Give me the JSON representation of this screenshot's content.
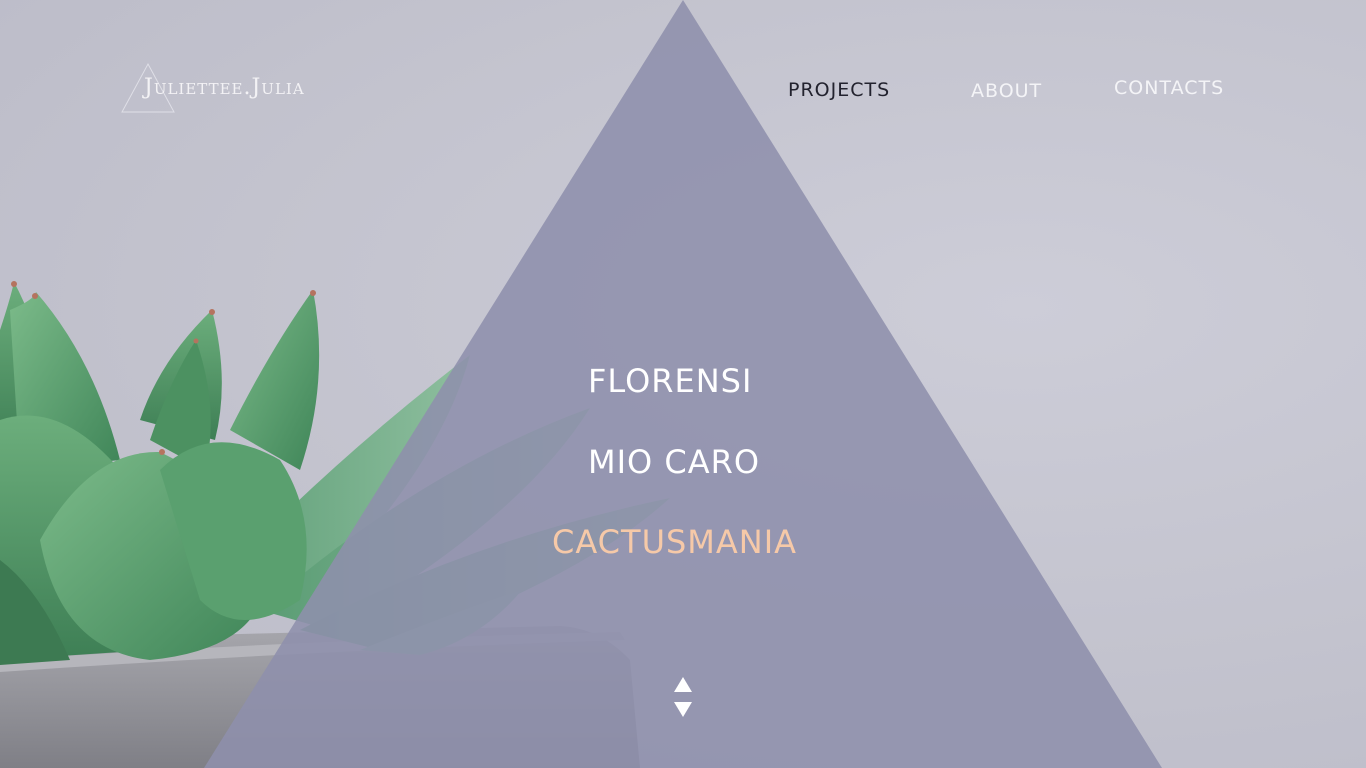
{
  "logo": {
    "text": "Juliettee.Julia"
  },
  "nav": {
    "items": [
      {
        "label": "PROJECTS",
        "active": true
      },
      {
        "label": "ABOUT",
        "active": false
      },
      {
        "label": "CONTACTS",
        "active": false
      }
    ]
  },
  "projects": [
    {
      "label": "FLORENSI",
      "active": false
    },
    {
      "label": "MIO CARO",
      "active": false
    },
    {
      "label": "CACTUSMANIA",
      "active": true
    }
  ],
  "colors": {
    "background": "#c4c4d0",
    "triangle": "#8e90ac",
    "nav_active": "#22222e",
    "nav_default": "#f4f4f7",
    "project_default": "#ffffff",
    "project_active": "#f6c9a8",
    "plant_green": "#4f9a68",
    "pot_gray": "#8f8f96"
  },
  "icons": {
    "scroll_up": "triangle-up-icon",
    "scroll_down": "triangle-down-icon",
    "logo_mark": "triangle-outline-icon"
  }
}
